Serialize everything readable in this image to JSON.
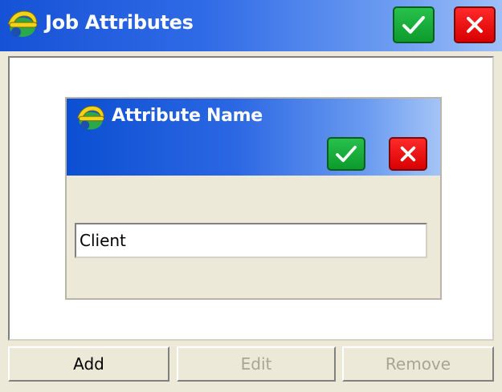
{
  "window": {
    "title": "Job Attributes",
    "ok_icon": "checkmark-icon",
    "cancel_icon": "close-icon"
  },
  "dialog": {
    "title": "Attribute Name",
    "field_value": "Client"
  },
  "buttons": {
    "add": "Add",
    "edit": "Edit",
    "remove": "Remove"
  },
  "colors": {
    "titlebar": "#1652d6",
    "ok_green": "#0d9b2c",
    "cancel_red": "#d80000"
  }
}
